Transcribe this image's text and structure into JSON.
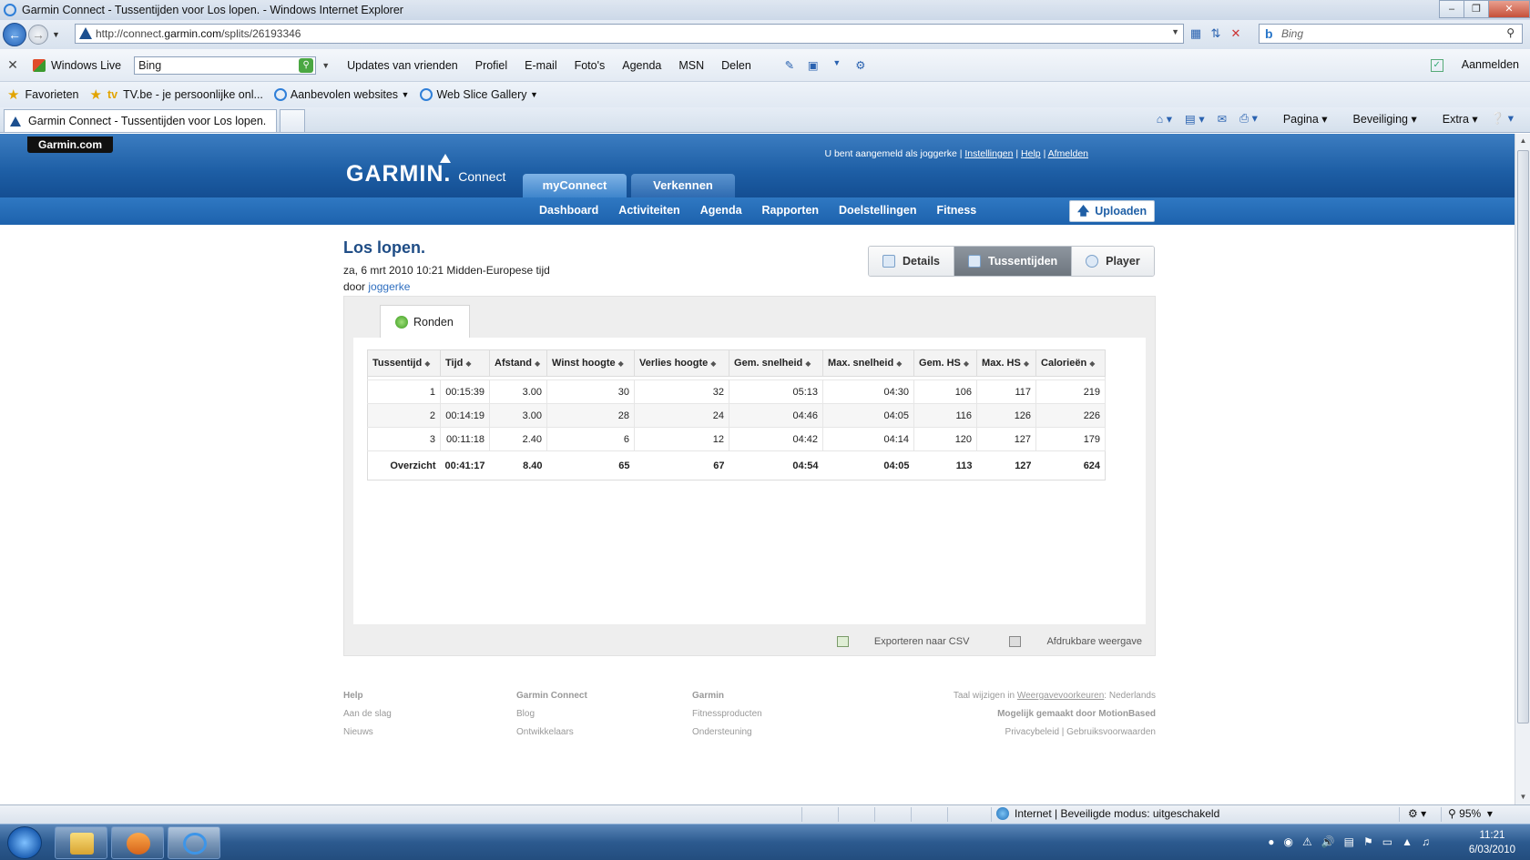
{
  "browser": {
    "window_title": "Garmin Connect - Tussentijden voor Los lopen. - Windows Internet Explorer",
    "url_prefix": "http://connect.",
    "url_domain": "garmin.com",
    "url_path": "/splits/26193346",
    "search_placeholder": "Bing",
    "toolbar": {
      "windows_live": "Windows Live",
      "search_value": "Bing",
      "links": [
        "Updates van vrienden",
        "Profiel",
        "E-mail",
        "Foto's",
        "Agenda",
        "MSN",
        "Delen"
      ],
      "signin": "Aanmelden"
    },
    "favorites": {
      "label": "Favorieten",
      "items": [
        "TV.be - je persoonlijke onl...",
        "Aanbevolen websites",
        "Web Slice Gallery"
      ],
      "tv_badge": "tv"
    },
    "tab_title": "Garmin Connect - Tussentijden voor Los lopen.",
    "commands": [
      "Pagina",
      "Beveiliging",
      "Extra"
    ],
    "status_zone": "Internet | Beveiligde modus: uitgeschakeld",
    "zoom": "95%"
  },
  "site": {
    "badge": "Garmin.com",
    "logo": "GARMIN.",
    "logo_sub": "Connect",
    "top_tabs": [
      "myConnect",
      "Verkennen"
    ],
    "user_prefix": "U bent aangemeld als joggerke |",
    "user_links": [
      "Instellingen",
      "Help",
      "Afmelden"
    ],
    "nav": [
      "Dashboard",
      "Activiteiten",
      "Agenda",
      "Rapporten",
      "Doelstellingen",
      "Fitness"
    ],
    "upload": "Uploaden"
  },
  "activity": {
    "title": "Los lopen.",
    "date": "za, 6 mrt 2010 10:21 Midden-Europese tijd",
    "by_prefix": "door",
    "by_user": "joggerke",
    "view_tabs": [
      "Details",
      "Tussentijden",
      "Player"
    ]
  },
  "splits": {
    "tab": "Ronden",
    "columns": [
      "Tussentijd",
      "Tijd",
      "Afstand",
      "Winst hoogte",
      "Verlies hoogte",
      "Gem. snelheid",
      "Max. snelheid",
      "Gem. HS",
      "Max. HS",
      "Calorieën"
    ],
    "rows": [
      [
        "1",
        "00:15:39",
        "3.00",
        "30",
        "32",
        "05:13",
        "04:30",
        "106",
        "117",
        "219"
      ],
      [
        "2",
        "00:14:19",
        "3.00",
        "28",
        "24",
        "04:46",
        "04:05",
        "116",
        "126",
        "226"
      ],
      [
        "3",
        "00:11:18",
        "2.40",
        "6",
        "12",
        "04:42",
        "04:14",
        "120",
        "127",
        "179"
      ]
    ],
    "summary": [
      "Overzicht",
      "00:41:17",
      "8.40",
      "65",
      "67",
      "04:54",
      "04:05",
      "113",
      "127",
      "624"
    ],
    "export_csv": "Exporteren naar CSV",
    "print_view": "Afdrukbare weergave"
  },
  "footer": {
    "col1": [
      "Help",
      "Aan de slag",
      "Nieuws"
    ],
    "col2": [
      "Garmin Connect",
      "Blog",
      "Ontwikkelaars"
    ],
    "col3": [
      "Garmin",
      "Fitnessproducten",
      "Ondersteuning"
    ],
    "lang_prefix": "Taal wijzigen in",
    "lang_link": "Weergavevoorkeuren",
    "lang_value": ": Nederlands",
    "powered": "Mogelijk gemaakt door MotionBased",
    "legal": "Privacybeleid | Gebruiksvoorwaarden"
  },
  "taskbar": {
    "time": "11:21",
    "date": "6/03/2010"
  }
}
